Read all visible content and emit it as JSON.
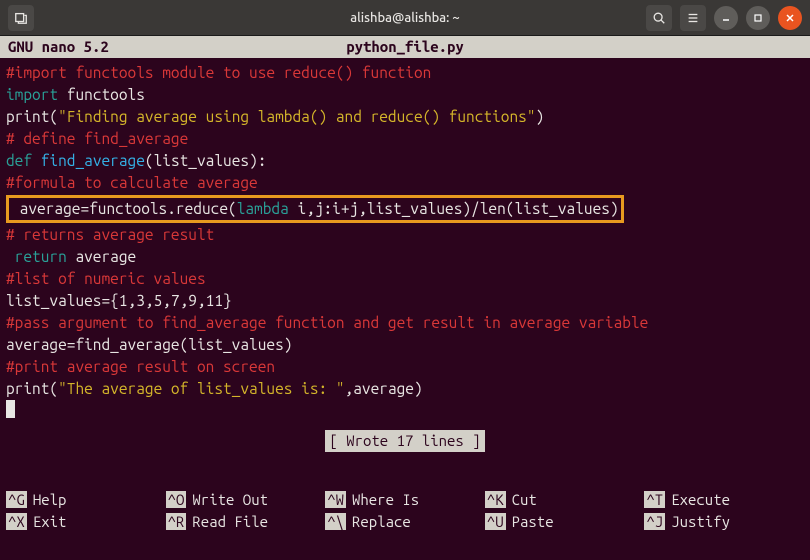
{
  "titlebar": {
    "title": "alishba@alishba: ~"
  },
  "nano": {
    "version": "GNU nano 5.2",
    "filename": "python_file.py"
  },
  "code": {
    "l1": "#import functools module to use reduce() function",
    "l2a": "import",
    "l2b": " functools",
    "l3a": "print(",
    "l3b": "\"Finding average using lambda() and reduce() functions\"",
    "l3c": ")",
    "l4": "# define find_average",
    "l5a": "def ",
    "l5b": "find_average",
    "l5c": "(list_values):",
    "l6": "#formula to calculate average",
    "l7a": " average=functools.reduce(",
    "l7b": "lambda",
    "l7c": " i,j:i+j,list_values)/len(list_values)",
    "l8": "# returns average result",
    "l9a": " return",
    "l9b": " average",
    "l10": "#list of numeric values",
    "l11": "list_values={1,3,5,7,9,11}",
    "l12": "#pass argument to find_average function and get result in average variable",
    "l13": "average=find_average(list_values)",
    "l14": "#print average result on screen",
    "l15a": "print(",
    "l15b": "\"The average of list_values is: \"",
    "l15c": ",average)"
  },
  "status": "[ Wrote 17 lines ]",
  "shortcuts": {
    "help_k": "^G",
    "help_l": "Help",
    "exit_k": "^X",
    "exit_l": "Exit",
    "writeout_k": "^O",
    "writeout_l": "Write Out",
    "readfile_k": "^R",
    "readfile_l": "Read File",
    "whereis_k": "^W",
    "whereis_l": "Where Is",
    "replace_k": "^\\",
    "replace_l": "Replace",
    "cut_k": "^K",
    "cut_l": "Cut",
    "paste_k": "^U",
    "paste_l": "Paste",
    "execute_k": "^T",
    "execute_l": "Execute",
    "justify_k": "^J",
    "justify_l": "Justify"
  }
}
